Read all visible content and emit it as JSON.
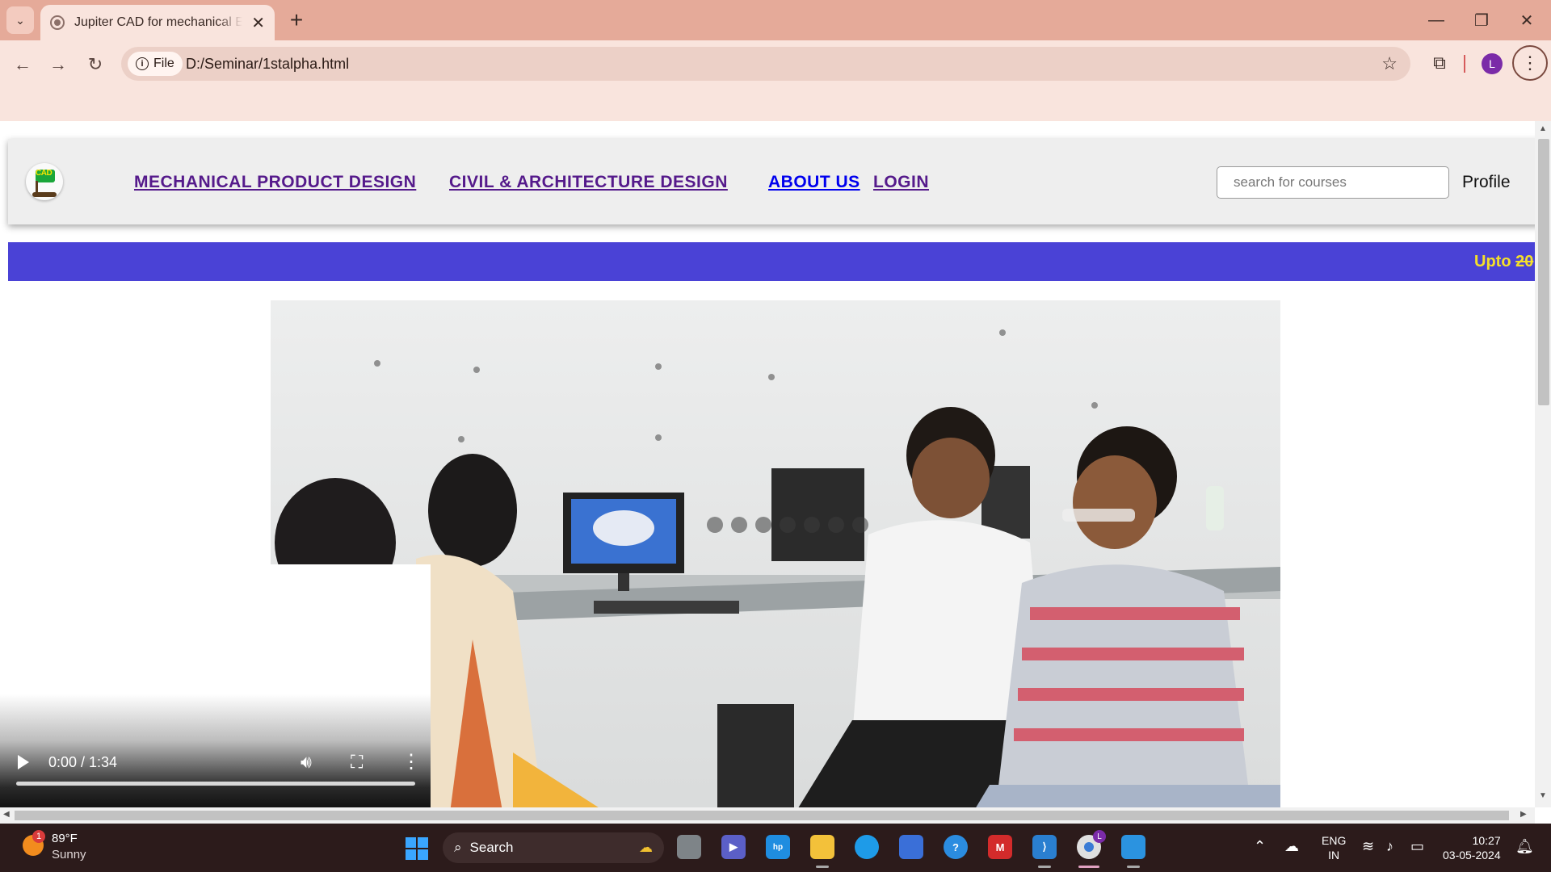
{
  "browser": {
    "tab_title": "Jupiter CAD for mechanical Eng",
    "tab_close": "✕",
    "new_tab": "+",
    "chip_label": "File",
    "url": "D:/Seminar/1stalpha.html",
    "profile_initial": "L"
  },
  "site": {
    "nav": [
      {
        "label": "MECHANICAL PRODUCT DESIGN"
      },
      {
        "label": "CIVIL & ARCHITECTURE DESIGN"
      },
      {
        "label": "ABOUT US"
      },
      {
        "label": "LOGIN"
      }
    ],
    "search_placeholder": "search for courses",
    "profile_label": "Profile",
    "marquee_prefix": "Upto ",
    "marquee_strike": "20",
    "logo_text": "CAD"
  },
  "video": {
    "time": "0:00 / 1:34"
  },
  "taskbar": {
    "temperature": "89°F",
    "condition": "Sunny",
    "weather_badge": "1",
    "search_label": "Search",
    "lang_1": "ENG",
    "lang_2": "IN",
    "time": "10:27",
    "date": "03-05-2024",
    "chrome_badge": "L"
  },
  "colors": {
    "tabbar": "#e5aa99",
    "marquee_band": "#4a42d6",
    "marquee_text": "#f5e02a",
    "nav_visited": "#551a8b",
    "nav_unvisited": "#0000ee"
  }
}
